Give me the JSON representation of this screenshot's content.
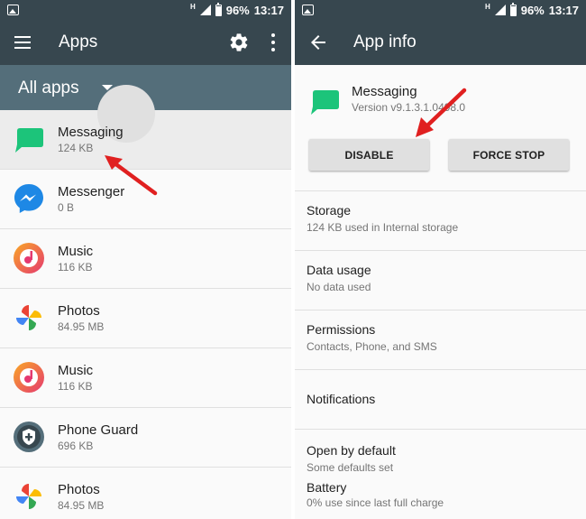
{
  "left": {
    "status": {
      "net": "H",
      "battery": "96%",
      "time": "13:17"
    },
    "appbar": {
      "title": "Apps",
      "icons": [
        "menu-icon",
        "gear-icon",
        "more-vert-icon"
      ]
    },
    "filter": {
      "label": "All apps"
    },
    "apps": [
      {
        "name": "Messaging",
        "size": "124 KB",
        "icon": "messaging-icon"
      },
      {
        "name": "Messenger",
        "size": "0 B",
        "icon": "messenger-icon"
      },
      {
        "name": "Music",
        "size": "116 KB",
        "icon": "music-icon"
      },
      {
        "name": "Photos",
        "size": "84.95 MB",
        "icon": "photos-icon"
      },
      {
        "name": "Music",
        "size": "116 KB",
        "icon": "music-icon"
      },
      {
        "name": "Phone Guard",
        "size": "696 KB",
        "icon": "shield-icon"
      },
      {
        "name": "Photos",
        "size": "84.95 MB",
        "icon": "photos-icon"
      }
    ]
  },
  "right": {
    "status": {
      "net": "H",
      "battery": "96%",
      "time": "13:17"
    },
    "appbar": {
      "title": "App info",
      "icons": [
        "back-arrow-icon"
      ]
    },
    "app": {
      "name": "Messaging",
      "version": "Version v9.1.3.1.0498.0"
    },
    "buttons": {
      "disable": "DISABLE",
      "force_stop": "FORCE STOP"
    },
    "settings": [
      {
        "title": "Storage",
        "subtitle": "124 KB used in Internal storage"
      },
      {
        "title": "Data usage",
        "subtitle": "No data used"
      },
      {
        "title": "Permissions",
        "subtitle": "Contacts, Phone, and SMS"
      },
      {
        "title": "Notifications",
        "subtitle": ""
      },
      {
        "title": "Open by default",
        "subtitle": "Some defaults set"
      },
      {
        "title": "Battery",
        "subtitle": "0% use since last full charge"
      }
    ]
  },
  "colors": {
    "toolbar": "#37474f",
    "filter_bar": "#546e7a",
    "annotation_arrow": "#e02020",
    "messaging_green": "#1cc47a",
    "messenger_blue": "#1e88e5",
    "music_orange": "#ef6c3a"
  }
}
